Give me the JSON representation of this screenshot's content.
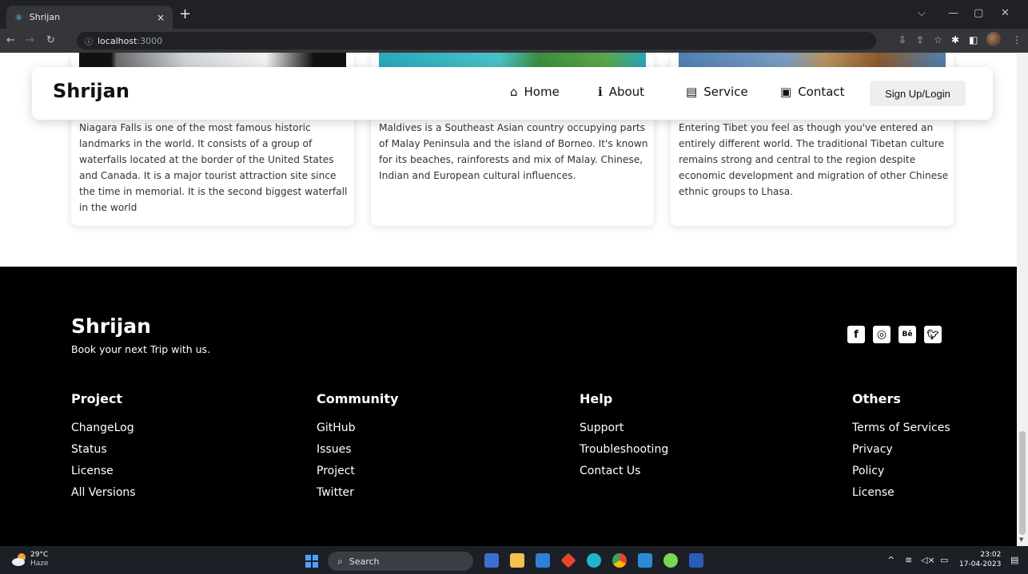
{
  "browser": {
    "tab_title": "Shrijan",
    "tab_close": "×",
    "new_tab": "+",
    "url_host": "localhost",
    "url_port": ":3000"
  },
  "navbar": {
    "brand": "Shrijan",
    "links": [
      {
        "label": "Home",
        "icon": "home-icon"
      },
      {
        "label": "About",
        "icon": "info-icon"
      },
      {
        "label": "Service",
        "icon": "briefcase-icon"
      },
      {
        "label": "Contact",
        "icon": "contact-book-icon"
      }
    ],
    "signup": "Sign Up/Login"
  },
  "cards": [
    {
      "text": "Niagara Falls is one of the most famous historic landmarks in the world. It consists of a group of waterfalls located at the border of the United States and Canada. It is a major tourist attraction site since the time in memorial. It is the second biggest waterfall in the world"
    },
    {
      "text": "Maldives is a Southeast Asian country occupying parts of Malay Peninsula and the island of Borneo. It's known for its beaches, rainforests and mix of Malay. Chinese, Indian and European cultural influences."
    },
    {
      "text": "Entering Tibet you feel as though you've entered an entirely different world. The traditional Tibetan culture remains strong and central to the region despite economic development and migration of other Chinese ethnic groups to Lhasa."
    }
  ],
  "footer": {
    "brand": "Shrijan",
    "tagline": "Book your next Trip with us.",
    "socials": [
      "facebook-icon",
      "instagram-icon",
      "behance-icon",
      "twitter-icon"
    ],
    "columns": [
      {
        "title": "Project",
        "items": [
          "ChangeLog",
          "Status",
          "License",
          "All Versions"
        ]
      },
      {
        "title": "Community",
        "items": [
          "GitHub",
          "Issues",
          "Project",
          "Twitter"
        ]
      },
      {
        "title": "Help",
        "items": [
          "Support",
          "Troubleshooting",
          "Contact Us"
        ]
      },
      {
        "title": "Others",
        "items": [
          "Terms of Services",
          "Privacy",
          "Policy",
          "License"
        ]
      }
    ]
  },
  "taskbar": {
    "temp": "29°C",
    "weather": "Haze",
    "search": "Search",
    "time": "23:02",
    "date": "17-04-2023"
  },
  "colors": {
    "footer_bg": "#000000",
    "chrome_dark": "#202124",
    "chrome_mid": "#35363a",
    "taskbar_bg": "#1c1f26"
  }
}
